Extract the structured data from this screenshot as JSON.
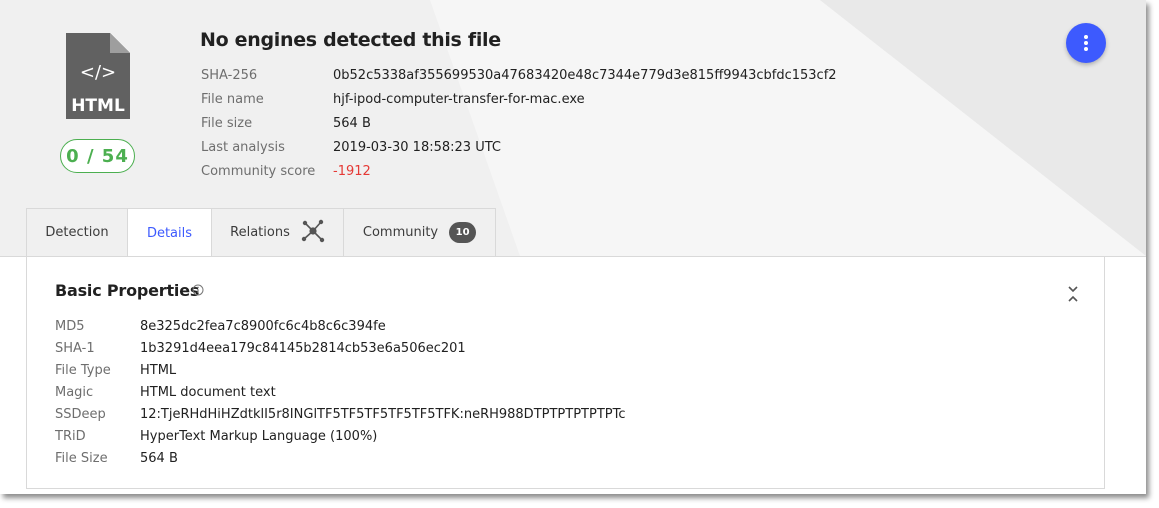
{
  "file_icon": {
    "type_label": "HTML",
    "glyph": "</>",
    "name": "html-file-icon"
  },
  "detection_score": "0 / 54",
  "title": "No engines detected this file",
  "file_info": [
    {
      "label": "SHA-256",
      "value": "0b52c5338af355699530a47683420e48c7344e779d3e815ff9943cbfdc153cf2"
    },
    {
      "label": "File name",
      "value": "hjf-ipod-computer-transfer-for-mac.exe"
    },
    {
      "label": "File size",
      "value": "564 B"
    },
    {
      "label": "Last analysis",
      "value": "2019-03-30 18:58:23 UTC"
    },
    {
      "label": "Community score",
      "value": "-1912"
    }
  ],
  "tabs": [
    {
      "label": "Detection"
    },
    {
      "label": "Details",
      "active": true
    },
    {
      "label": "Relations",
      "icon": "graph-nodes-icon"
    },
    {
      "label": "Community",
      "badge": "10"
    }
  ],
  "basic_properties": {
    "title": "Basic Properties",
    "rows": [
      {
        "label": "MD5",
        "value": "8e325dc2fea7c8900fc6c4b8c6c394fe"
      },
      {
        "label": "SHA-1",
        "value": "1b3291d4eea179c84145b2814cb53e6a506ec201"
      },
      {
        "label": "File Type",
        "value": "HTML"
      },
      {
        "label": "Magic",
        "value": "HTML document text"
      },
      {
        "label": "SSDeep",
        "value": "12:TjeRHdHiHZdtklI5r8INGlTF5TF5TF5TF5TF5TFK:neRH988DTPTPTPTPTPTc"
      },
      {
        "label": "TRiD",
        "value": "HyperText Markup Language (100%)"
      },
      {
        "label": "File Size",
        "value": "564 B"
      }
    ]
  },
  "colors": {
    "accent": "#3d5afe",
    "clean_green": "#4caf50",
    "negative_red": "#e53935",
    "header_bg": "#f0f0f0"
  }
}
